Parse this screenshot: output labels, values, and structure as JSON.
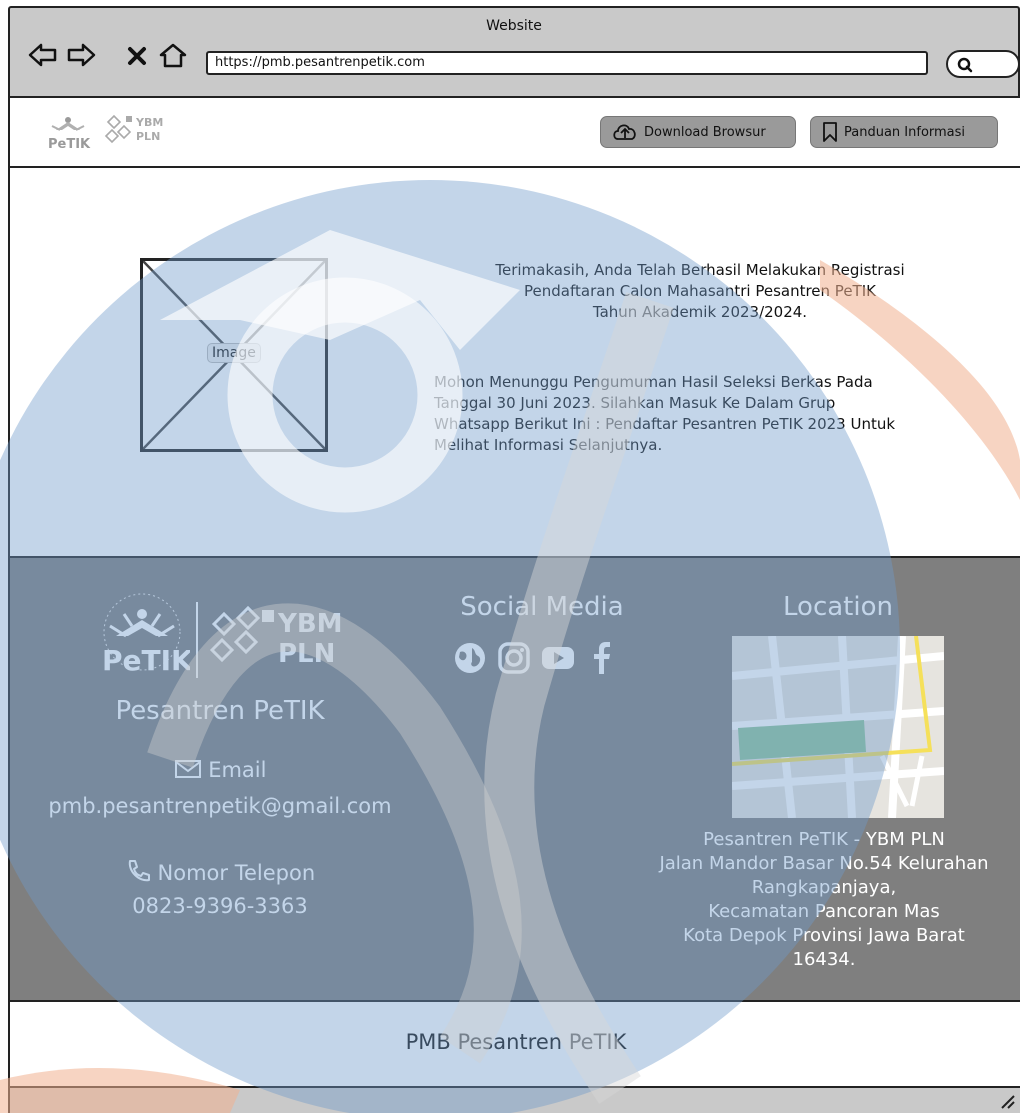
{
  "browser": {
    "window_title": "Website",
    "url": "https://pmb.pesantrenpetik.com"
  },
  "header": {
    "logo_petik_text": "PeTIK",
    "logo_ybm_text": [
      "YBM",
      "PLN"
    ],
    "download_label": "Download Browsur",
    "panduan_label": "Panduan Informasi"
  },
  "main": {
    "image_label": "Image",
    "message_lines": [
      "Terimakasih, Anda Telah Berhasil Melakukan Registrasi",
      "Pendaftaran Calon Mahasantri Pesantren PeTIK",
      "Tahun Akademik 2023/2024."
    ],
    "info_lines": [
      "Mohon Menunggu Pengumuman Hasil Seleksi Berkas Pada",
      "Tanggal 30 Juni 2023. Silahkan Masuk Ke Dalam Grup",
      "Whatsapp Berikut Ini : Pendaftar Pesantren PeTIK 2023 Untuk",
      "Melihat Informasi Selanjutnya."
    ]
  },
  "footer": {
    "org_name": "Pesantren PeTIK",
    "email_label": "Email",
    "email": "pmb.pesantrenpetik@gmail.com",
    "phone_label": "Nomor Telepon",
    "phone": "0823-9396-3363",
    "social_title": "Social Media",
    "social_icons": [
      "globe-icon",
      "instagram-icon",
      "youtube-icon",
      "facebook-icon"
    ],
    "location_title": "Location",
    "address_lines": [
      "Pesantren PeTIK - YBM PLN",
      "Jalan Mandor Basar No.54 Kelurahan",
      "Rangkapanjaya,",
      "Kecamatan Pancoran Mas",
      "Kota Depok Provinsi Jawa Barat",
      "16434."
    ]
  },
  "bottom": {
    "text": "PMB Pesantren PeTIK"
  },
  "colors": {
    "chrome": "#c9c9c9",
    "button": "#9a9a9a",
    "footer": "#7f7f7f",
    "watermark_blue": "#6f9ccb",
    "watermark_orange": "#f0b08f"
  }
}
